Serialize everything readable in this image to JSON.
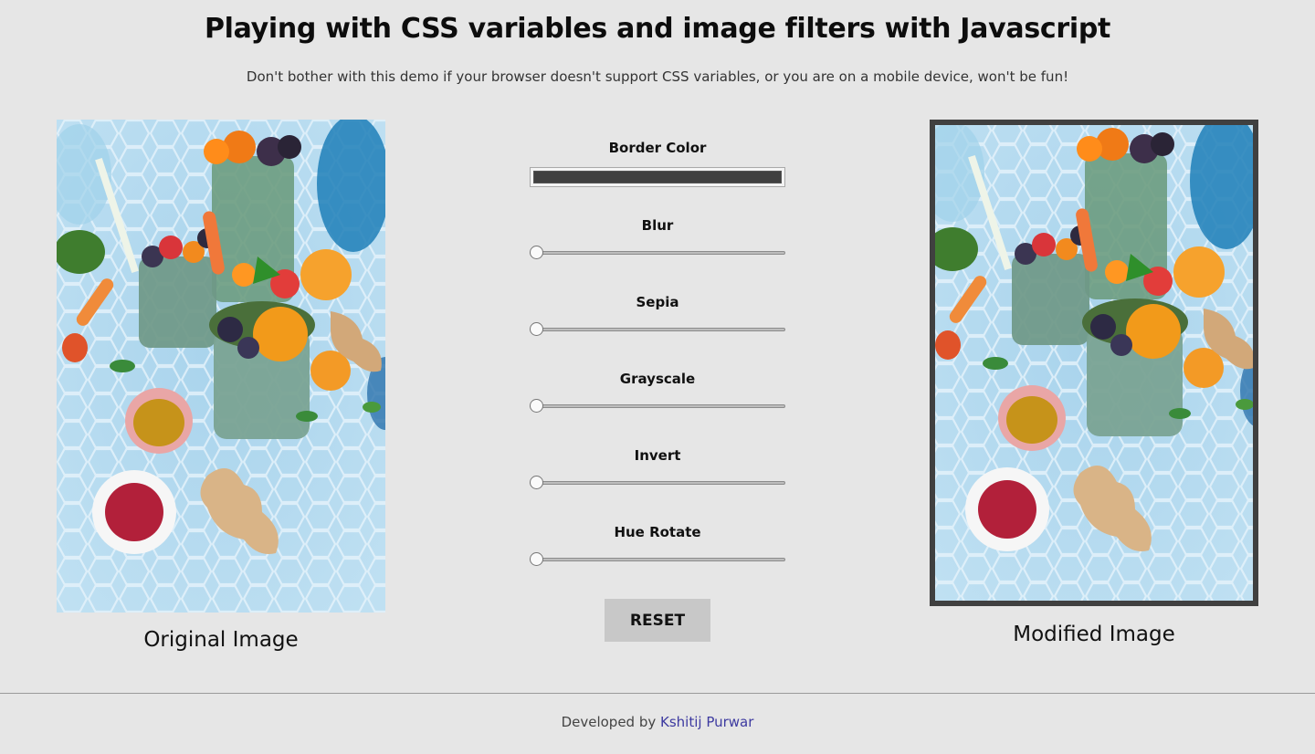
{
  "header": {
    "title": "Playing with CSS variables and image filters with Javascript",
    "subtitle": "Don't bother with this demo if your browser doesn't support CSS variables, or you are on a mobile device, won't be fun!"
  },
  "images": {
    "original_caption": "Original Image",
    "modified_caption": "Modified Image",
    "border_color": "#404040"
  },
  "controls": {
    "border_color": {
      "label": "Border Color",
      "value": "#404040"
    },
    "blur": {
      "label": "Blur",
      "value": 0
    },
    "sepia": {
      "label": "Sepia",
      "value": 0
    },
    "grayscale": {
      "label": "Grayscale",
      "value": 0
    },
    "invert": {
      "label": "Invert",
      "value": 0
    },
    "hue_rotate": {
      "label": "Hue Rotate",
      "value": 0
    },
    "reset_label": "RESET"
  },
  "footer": {
    "prefix": "Developed by",
    "author": "Kshitij Purwar"
  }
}
